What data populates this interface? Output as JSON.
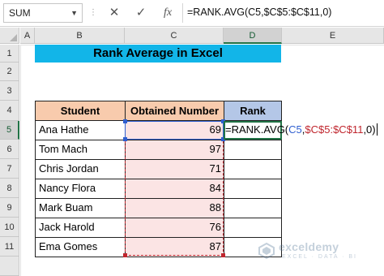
{
  "formula_bar": {
    "name_box": "SUM",
    "cancel_icon": "✕",
    "enter_icon": "✓",
    "fx_icon": "fx",
    "formula": "=RANK.AVG(C5,$C$5:$C$11,0)"
  },
  "columns": [
    "A",
    "B",
    "C",
    "D",
    "E"
  ],
  "rows": [
    "1",
    "2",
    "3",
    "4",
    "5",
    "6",
    "7",
    "8",
    "9",
    "10",
    "11"
  ],
  "selected_column": "D",
  "selected_row": "5",
  "title": "Rank Average in Excel",
  "table": {
    "headers": {
      "student": "Student",
      "obtained": "Obtained Number",
      "rank": "Rank"
    },
    "rows": [
      {
        "student": "Ana Hathe",
        "obtained": "69"
      },
      {
        "student": "Tom Mach",
        "obtained": "97"
      },
      {
        "student": "Chris Jordan",
        "obtained": "71"
      },
      {
        "student": "Nancy Flora",
        "obtained": "84"
      },
      {
        "student": "Mark Buam",
        "obtained": "88"
      },
      {
        "student": "Jack Harold",
        "obtained": "76"
      },
      {
        "student": "Ema Gomes",
        "obtained": "87"
      }
    ]
  },
  "editing": {
    "fn": "=RANK.AVG(",
    "ref": "C5",
    "comma1": ",",
    "range": "$C$5:$C$11",
    "rest": ",0)"
  },
  "watermark": {
    "brand": "exceldemy",
    "tagline": "EXCEL · DATA · BI"
  },
  "colors": {
    "title_bg": "#12b5e8",
    "header_bg": "#f8cbad",
    "rank_header_bg": "#b4c7e7",
    "selection": "#217346",
    "range_border": "#c0262e",
    "ref_border": "#2f5fd0"
  }
}
